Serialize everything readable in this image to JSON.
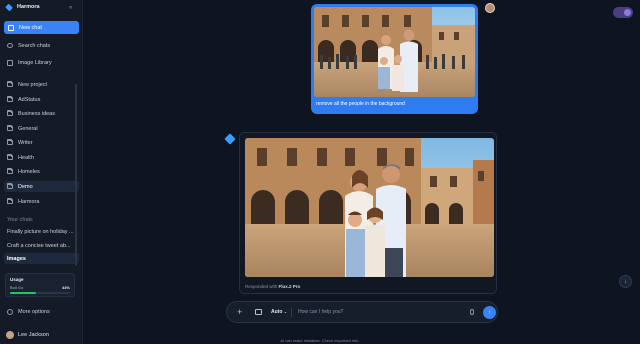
{
  "sidebar": {
    "brand": "Harmora",
    "new_chat": "New chat",
    "search_chats": "Search chats",
    "image_library": "Image Library",
    "new_project": "New project",
    "projects": [
      "AdStatus",
      "Business ideas",
      "General",
      "Writer",
      "Health",
      "Homeles",
      "Demo",
      "Harmora"
    ],
    "your_chats_heading": "Your chats",
    "chats": [
      "Finally picture on holiday ...",
      "Craft a concise tweet ab...",
      "Images"
    ],
    "usage": {
      "title": "Usage",
      "label": "Bolt Go",
      "percent": "44%",
      "fraction": 0.44
    },
    "more_options": "More options",
    "user_name": "Lee Jackson"
  },
  "conversation": {
    "user_message": "remove all the people in the background",
    "response_footer_prefix": "Responded with",
    "response_model": "Flux.2 Pro"
  },
  "composer": {
    "mode": "Auto",
    "placeholder": "How can I help you?"
  },
  "disclaimer": "AI can make mistakes. Check important info.",
  "colors": {
    "accent": "#3b82f6",
    "usage_fill": "#22c55e"
  }
}
